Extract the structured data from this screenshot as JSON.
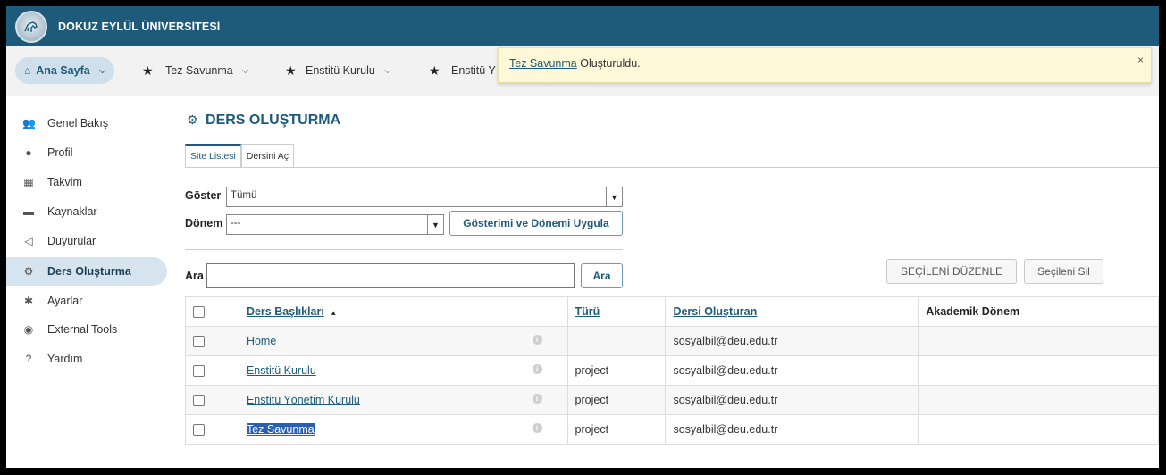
{
  "brand": {
    "name": "DOKUZ EYLÜL ÜNİVERSİTESİ"
  },
  "tabs": [
    {
      "label": "Ana Sayfa"
    },
    {
      "label": "Tez Savunma"
    },
    {
      "label": "Enstitü Kurulu"
    },
    {
      "label": "Enstitü Y"
    }
  ],
  "alert": {
    "link": "Tez Savunma",
    "text": "Oluşturuldu.",
    "close": "×"
  },
  "sidebar": {
    "items": [
      {
        "label": "Genel Bakış"
      },
      {
        "label": "Profil"
      },
      {
        "label": "Takvim"
      },
      {
        "label": "Kaynaklar"
      },
      {
        "label": "Duyurular"
      },
      {
        "label": "Ders Oluşturma"
      },
      {
        "label": "Ayarlar"
      },
      {
        "label": "External Tools"
      },
      {
        "label": "Yardım"
      }
    ]
  },
  "page": {
    "title": "DERS OLUŞTURMA",
    "subtabs": [
      "Site Listesi",
      "Dersini Aç"
    ]
  },
  "filters": {
    "show_label": "Göster",
    "show_value": "Tümü",
    "term_label": "Dönem",
    "term_value": "---",
    "apply_button": "Gösterimi ve Dönemi Uygula",
    "search_label": "Ara",
    "search_value": "",
    "search_button": "Ara",
    "edit_button": "SEÇİLENİ DÜZENLE",
    "delete_button": "Seçileni Sil"
  },
  "table": {
    "headers": {
      "title": "Ders Başlıkları",
      "sort_icon": "▲",
      "type": "Türü",
      "creator": "Dersi Oluşturan",
      "term": "Akademik Dönem"
    },
    "rows": [
      {
        "title": "Home",
        "type": "",
        "creator": "sosyalbil@deu.edu.tr",
        "term": ""
      },
      {
        "title": "Enstitü Kurulu",
        "type": "project",
        "creator": "sosyalbil@deu.edu.tr",
        "term": ""
      },
      {
        "title": "Enstitü Yönetim Kurulu",
        "type": "project",
        "creator": "sosyalbil@deu.edu.tr",
        "term": ""
      },
      {
        "title": "Tez Savunma",
        "type": "project",
        "creator": "sosyalbil@deu.edu.tr",
        "term": ""
      }
    ]
  },
  "colors": {
    "header": "#1e5b7b",
    "accent": "#1e5b7b",
    "alert_bg": "#fcf8d8",
    "active_nav": "#d5e4ee"
  }
}
